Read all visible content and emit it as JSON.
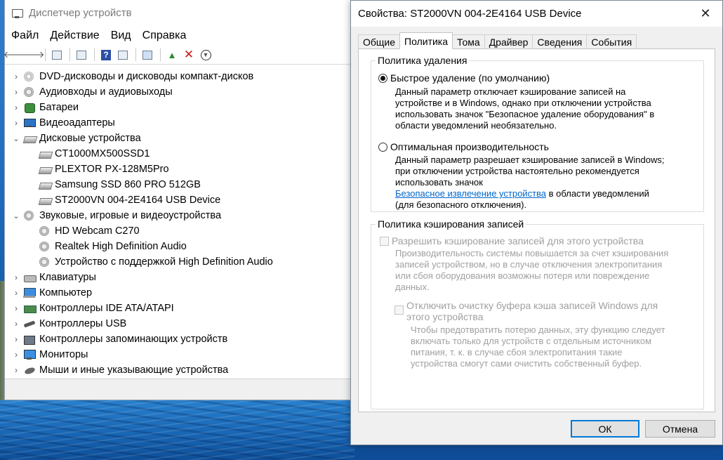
{
  "device_manager": {
    "title": "Диспетчер устройств",
    "menu": [
      "Файл",
      "Действие",
      "Вид",
      "Справка"
    ],
    "tree": [
      {
        "label": "DVD-дисководы и дисководы компакт-дисков",
        "icon": "disc-icon",
        "expanded": false
      },
      {
        "label": "Аудиовходы и аудиовыходы",
        "icon": "audio-icon",
        "expanded": false
      },
      {
        "label": "Батареи",
        "icon": "battery-icon",
        "expanded": false
      },
      {
        "label": "Видеоадаптеры",
        "icon": "display-adapter-icon",
        "expanded": false
      },
      {
        "label": "Дисковые устройства",
        "icon": "disk-drive-icon",
        "expanded": true,
        "children": [
          "CT1000MX500SSD1",
          "PLEXTOR PX-128M5Pro",
          "Samsung SSD 860 PRO 512GB",
          "ST2000VN 004-2E4164 USB Device"
        ]
      },
      {
        "label": "Звуковые, игровые и видеоустройства",
        "icon": "sound-icon",
        "expanded": true,
        "children": [
          "HD Webcam C270",
          "Realtek High Definition Audio",
          "Устройство с поддержкой High Definition Audio"
        ]
      },
      {
        "label": "Клавиатуры",
        "icon": "keyboard-icon",
        "expanded": false
      },
      {
        "label": "Компьютер",
        "icon": "computer-icon",
        "expanded": false
      },
      {
        "label": "Контроллеры IDE ATA/ATAPI",
        "icon": "ide-controller-icon",
        "expanded": false
      },
      {
        "label": "Контроллеры USB",
        "icon": "usb-controller-icon",
        "expanded": false
      },
      {
        "label": "Контроллеры запоминающих устройств",
        "icon": "storage-controller-icon",
        "expanded": false
      },
      {
        "label": "Мониторы",
        "icon": "monitor-icon",
        "expanded": false
      },
      {
        "label": "Мыши и иные указывающие устройства",
        "icon": "mouse-icon",
        "expanded": false
      }
    ]
  },
  "dialog": {
    "title": "Свойства: ST2000VN 004-2E4164 USB Device",
    "tabs": [
      "Общие",
      "Политика",
      "Тома",
      "Драйвер",
      "Сведения",
      "События"
    ],
    "active_tab": "Политика",
    "removal_group": {
      "label": "Политика удаления",
      "quick": {
        "label": "Быстрое удаление (по умолчанию)",
        "checked": true,
        "desc_1": "Данный параметр отключает кэширование записей на",
        "desc_2": "устройстве и в Windows, однако при отключении устройства",
        "desc_3": "использовать значок \"Безопасное удаление оборудования\" в",
        "desc_4": "области уведомлений необязательно."
      },
      "better": {
        "label": "Оптимальная производительность",
        "checked": false,
        "desc_1": "Данный параметр разрешает кэширование записей в Windows;",
        "desc_2": "при отключении устройства настоятельно рекомендуется",
        "desc_3": "использовать значок",
        "link": "Безопасное извлечение устройства",
        "desc_4": " в области уведомлений",
        "desc_5": "(для безопасного отключения)."
      }
    },
    "cache_group": {
      "label": "Политика кэширования записей",
      "enable": {
        "label": "Разрешить кэширование записей для этого устройства",
        "desc_1": "Производительность системы повышается за счет кэширования",
        "desc_2": "записей устройством, но в случае отключения электропитания",
        "desc_3": "или сбоя оборудования возможны потеря или повреждение",
        "desc_4": "данных."
      },
      "flush": {
        "label_1": "Отключить очистку буфера кэша записей Windows для",
        "label_2": "этого устройства",
        "desc_1": "Чтобы предотвратить потерю данных, эту функцию следует",
        "desc_2": "включать только для устройств с отдельным источником",
        "desc_3": "питания, т. к. в случае сбоя электропитания такие",
        "desc_4": "устройства смогут сами очистить собственный буфер."
      }
    },
    "ok_label": "ОК",
    "cancel_label": "Отмена"
  }
}
